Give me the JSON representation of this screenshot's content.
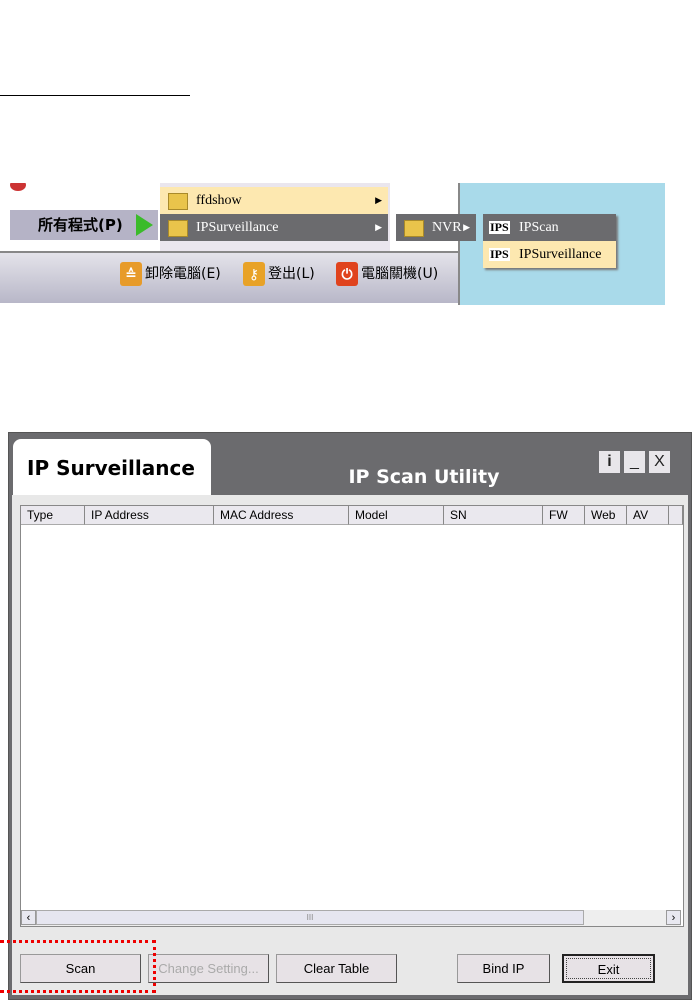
{
  "start_menu": {
    "all_programs": "所有程式(P)",
    "submenu1": [
      {
        "label": "ffdshow"
      },
      {
        "label": "IPSurveillance"
      }
    ],
    "submenu2": [
      {
        "label": "NVR"
      }
    ],
    "submenu3": [
      {
        "label": "IPScan",
        "icon": "IPS"
      },
      {
        "label": "IPSurveillance",
        "icon": "IPS"
      }
    ],
    "bottom": [
      {
        "label": "卸除電腦(E)",
        "icon": "eject-icon"
      },
      {
        "label": "登出(L)",
        "icon": "key-icon"
      },
      {
        "label": "電腦關機(U)",
        "icon": "power-icon"
      }
    ]
  },
  "window": {
    "tab": "IP Surveillance",
    "title": "IP Scan Utility",
    "controls": {
      "info": "i",
      "minimize": "_",
      "close": "X"
    },
    "columns": [
      "Type",
      "IP Address",
      "MAC Address",
      "Model",
      "SN",
      "FW",
      "Web",
      "AV"
    ],
    "buttons": {
      "scan": "Scan",
      "change": "Change Setting...",
      "clear": "Clear Table",
      "bind": "Bind IP",
      "exit": "Exit"
    },
    "scroll_thumb": "III"
  }
}
